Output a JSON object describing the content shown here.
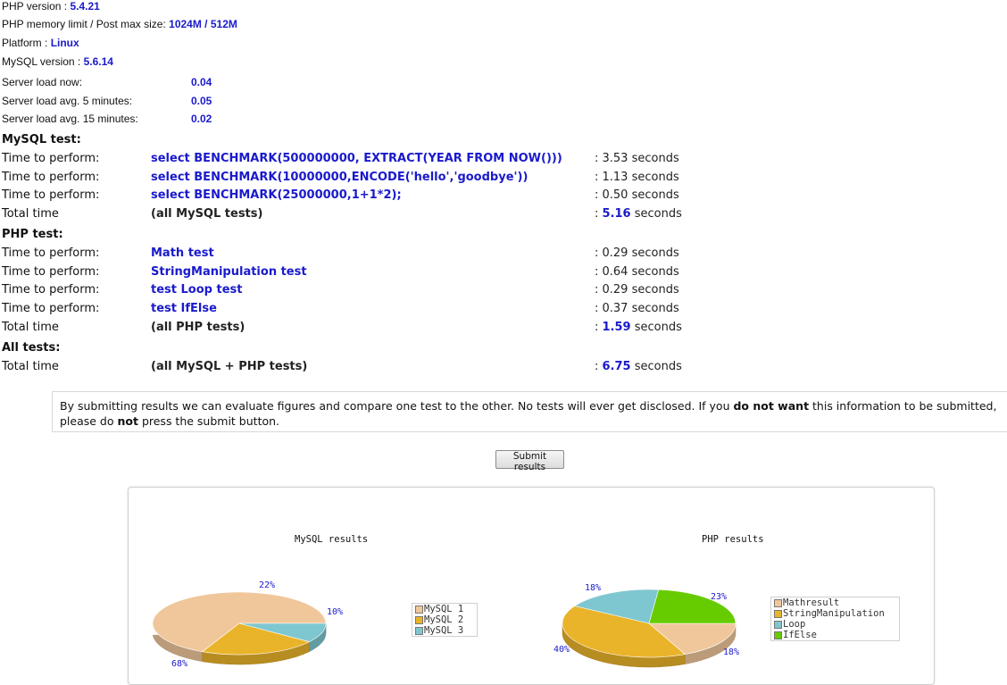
{
  "server_info": {
    "php_version_label": "PHP version : ",
    "php_version": "5.4.21",
    "memory_label": "PHP memory limit / Post max size: ",
    "memory_value": "1024M / 512M",
    "platform_label": "Platform : ",
    "platform": "Linux",
    "mysql_version_label": "MySQL version : ",
    "mysql_version": "5.6.14",
    "loads": [
      {
        "label": "Server load now:",
        "value": "0.04"
      },
      {
        "label": "Server load avg. 5 minutes:",
        "value": "0.05"
      },
      {
        "label": "Server load avg. 15 minutes:",
        "value": "0.02"
      }
    ]
  },
  "mysql": {
    "heading": "MySQL test:",
    "rows": [
      {
        "label": "Time to perform:",
        "test": "select BENCHMARK(500000000, EXTRACT(YEAR FROM NOW()))",
        "result": ": 3.53 seconds"
      },
      {
        "label": "Time to perform:",
        "test": "select BENCHMARK(10000000,ENCODE('hello','goodbye'))",
        "result": ": 1.13 seconds"
      },
      {
        "label": "Time to perform:",
        "test": "select BENCHMARK(25000000,1+1*2);",
        "result": ": 0.50 seconds"
      }
    ],
    "total": {
      "label": "Total time",
      "desc": "(all MySQL tests)",
      "prefix": ": ",
      "value": "5.16",
      "unit": " seconds"
    }
  },
  "php": {
    "heading": "PHP test:",
    "rows": [
      {
        "label": "Time to perform:",
        "test": "Math test",
        "result": ": 0.29 seconds"
      },
      {
        "label": "Time to perform:",
        "test": "StringManipulation test",
        "result": ": 0.64 seconds"
      },
      {
        "label": "Time to perform:",
        "test": "test Loop test",
        "result": ": 0.29 seconds"
      },
      {
        "label": "Time to perform:",
        "test": "test IfElse",
        "result": ": 0.37 seconds"
      }
    ],
    "total": {
      "label": "Total time",
      "desc": "(all PHP tests)",
      "prefix": ": ",
      "value": "1.59",
      "unit": " seconds"
    }
  },
  "all": {
    "heading": "All tests:",
    "total": {
      "label": "Total time",
      "desc": "(all MySQL + PHP tests)",
      "prefix": ": ",
      "value": "6.75",
      "unit": " seconds"
    }
  },
  "notice": {
    "part1": "By submitting results we can evaluate figures and compare one test to the other. No tests will ever get disclosed. If you ",
    "bold1": "do not want",
    "part2": " this information to be submitted, please do ",
    "bold2": "not",
    "part3": " press the submit button."
  },
  "submit_label": "Submit results",
  "colors": {
    "accent_blue": "#1a1acc"
  },
  "chart_data": [
    {
      "type": "pie",
      "title": "MySQL results",
      "categories": [
        "MySQL 1",
        "MySQL 2",
        "MySQL 3"
      ],
      "values": [
        68,
        22,
        10
      ],
      "labels": [
        "68%",
        "22%",
        "10%"
      ],
      "colors": [
        "#f0c79b",
        "#eab42a",
        "#7fc7d0"
      ],
      "legend": "right"
    },
    {
      "type": "pie",
      "title": "PHP results",
      "categories": [
        "Mathresult",
        "StringManipulation",
        "Loop",
        "IfElse"
      ],
      "values": [
        18,
        40,
        18,
        23
      ],
      "labels": [
        "18%",
        "40%",
        "18%",
        "23%"
      ],
      "colors": [
        "#f0c79b",
        "#eab42a",
        "#7fc7d0",
        "#66cc00"
      ],
      "legend": "right"
    }
  ]
}
